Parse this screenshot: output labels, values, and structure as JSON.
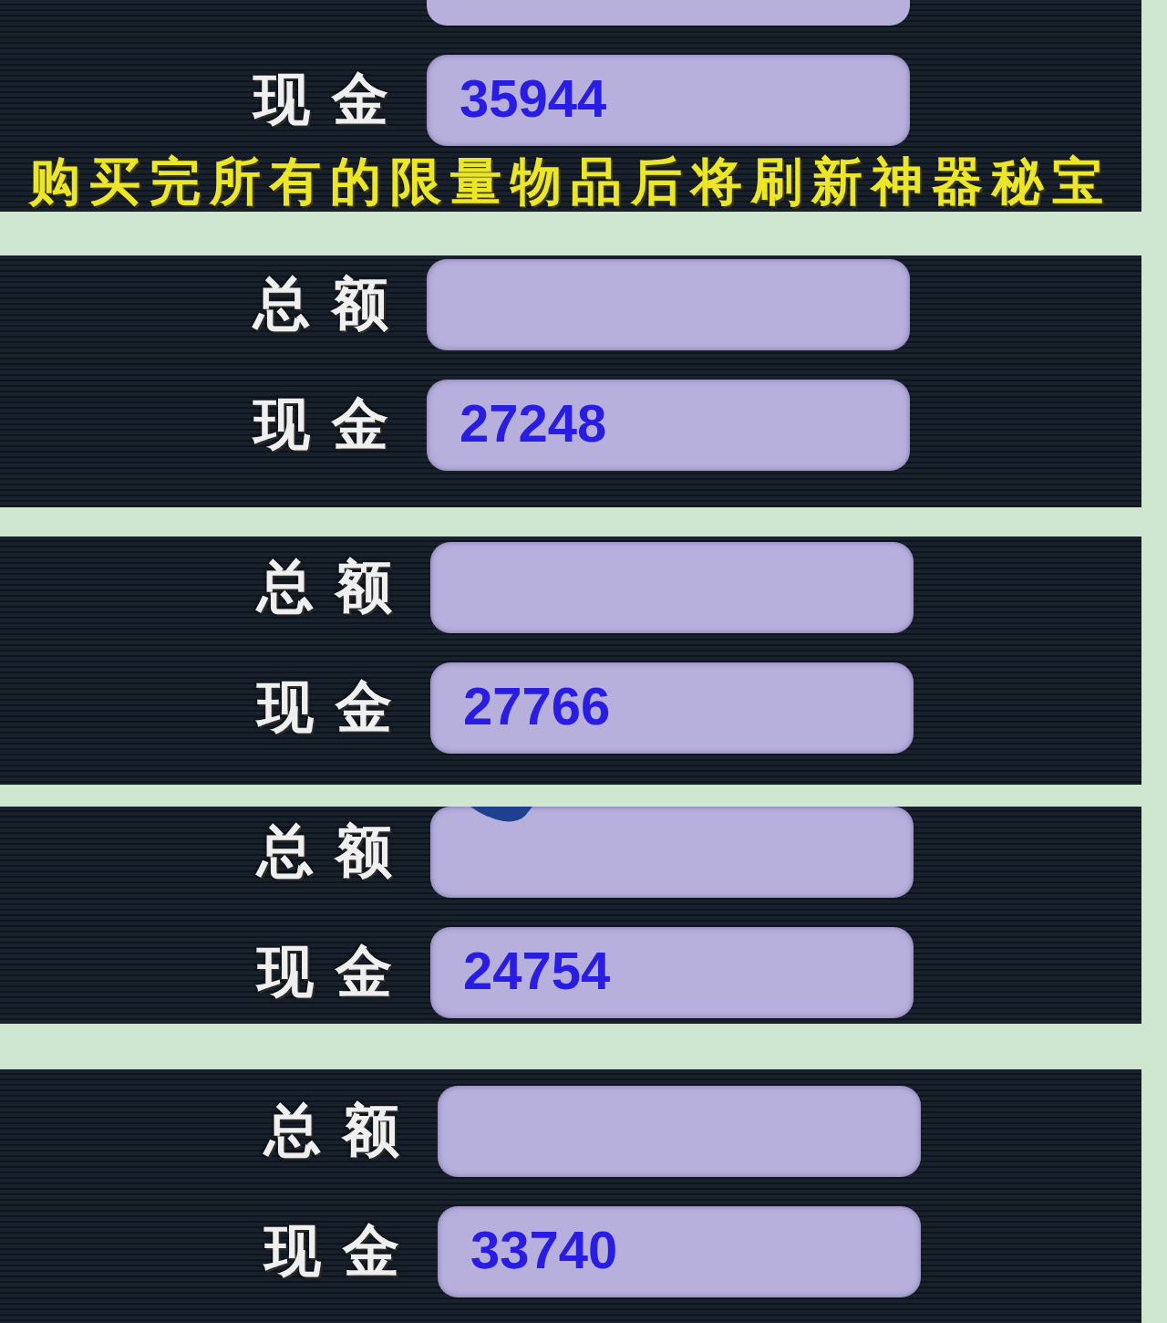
{
  "panels": [
    {
      "rows": [
        {
          "kind": "clipped"
        },
        {
          "kind": "field",
          "label": "现金",
          "value": "35944"
        }
      ],
      "notice": "购买完所有的限量物品后将刷新神器秘宝",
      "marker": false
    },
    {
      "rows": [
        {
          "kind": "field",
          "label": "总额"
        },
        {
          "kind": "field",
          "label": "现金",
          "value": "27248"
        }
      ],
      "marker": false
    },
    {
      "rows": [
        {
          "kind": "field",
          "label": "总额"
        },
        {
          "kind": "field",
          "label": "现金",
          "value": "27766"
        }
      ],
      "marker": false
    },
    {
      "rows": [
        {
          "kind": "field",
          "label": "总额"
        },
        {
          "kind": "field",
          "label": "现金",
          "value": "24754"
        }
      ],
      "marker": true
    },
    {
      "rows": [
        {
          "kind": "field",
          "label": "总额"
        },
        {
          "kind": "field",
          "label": "现金",
          "value": "33740"
        }
      ],
      "marker": false
    }
  ]
}
